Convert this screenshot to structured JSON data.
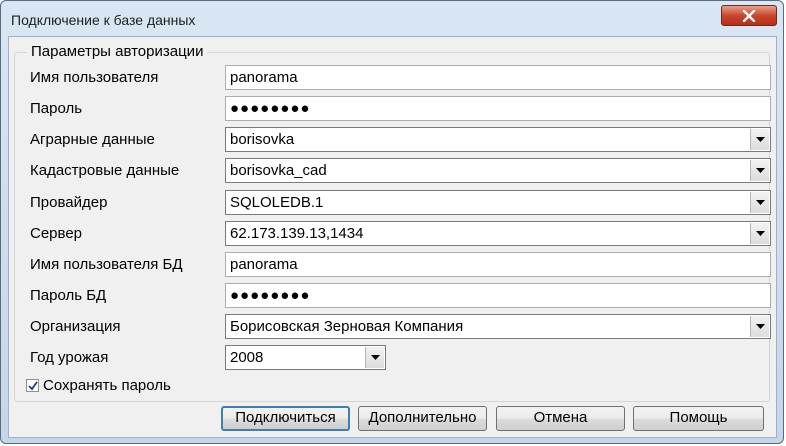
{
  "window": {
    "title": "Подключение к базе данных"
  },
  "group": {
    "legend": "Параметры авторизации"
  },
  "fields": [
    {
      "label": "Имя пользователя",
      "value": "panorama",
      "type": "text"
    },
    {
      "label": "Пароль",
      "value": "●●●●●●●●",
      "type": "password"
    },
    {
      "label": "Аграрные данные",
      "value": "borisovka",
      "type": "combo"
    },
    {
      "label": "Кадастровые данные",
      "value": "borisovka_cad",
      "type": "combo"
    },
    {
      "label": "Провайдер",
      "value": "SQLOLEDB.1",
      "type": "combo"
    },
    {
      "label": "Сервер",
      "value": "62.173.139.13,1434",
      "type": "combo"
    },
    {
      "label": "Имя пользователя БД",
      "value": "panorama",
      "type": "text"
    },
    {
      "label": "Пароль БД",
      "value": "●●●●●●●●",
      "type": "password"
    },
    {
      "label": "Организация",
      "value": "Борисовская Зерновая Компания",
      "type": "combo"
    },
    {
      "label": "Год урожая",
      "value": "2008",
      "type": "combo"
    }
  ],
  "save_password": {
    "label": "Сохранять пароль",
    "checked": true
  },
  "buttons": {
    "connect": "Подключиться",
    "advanced": "Дополнительно",
    "cancel": "Отмена",
    "help": "Помощь"
  }
}
